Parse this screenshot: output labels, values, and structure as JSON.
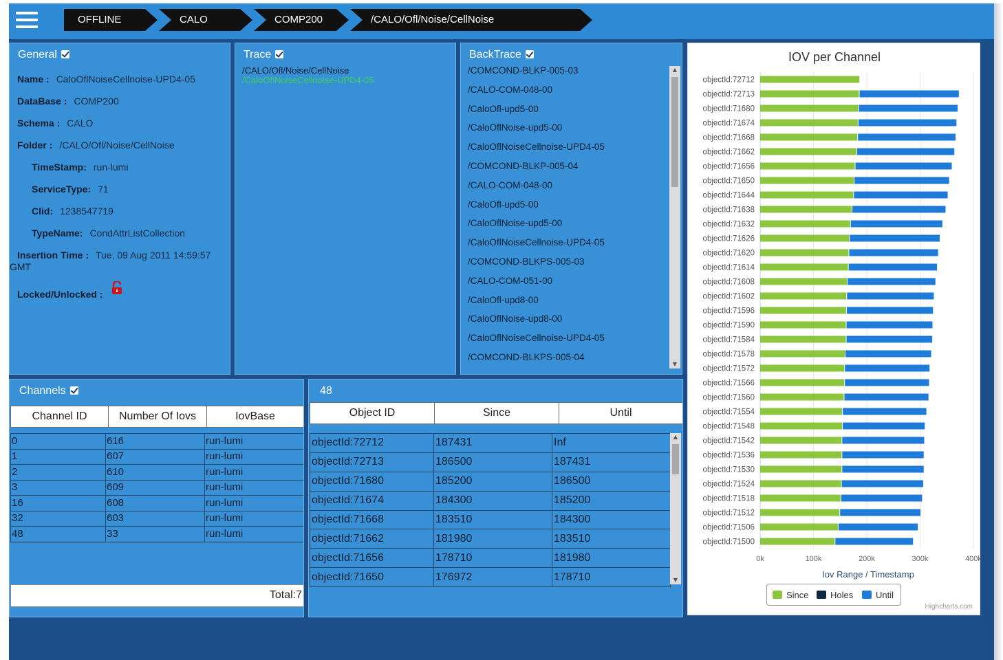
{
  "breadcrumbs": [
    "OFFLINE",
    "CALO",
    "COMP200",
    "/CALO/Ofl/Noise/CellNoise"
  ],
  "general": {
    "title": "General",
    "rows": [
      {
        "label": "Name :",
        "value": "CaloOflNoiseCellnoise-UPD4-05"
      },
      {
        "label": "DataBase :",
        "value": "COMP200"
      },
      {
        "label": "Schema :",
        "value": "CALO"
      },
      {
        "label": "Folder :",
        "value": "/CALO/Ofl/Noise/CellNoise"
      },
      {
        "label": "TimeStamp:",
        "value": "run-lumi"
      },
      {
        "label": "ServiceType:",
        "value": "71"
      },
      {
        "label": "Clid:",
        "value": "1238547719"
      },
      {
        "label": "TypeName:",
        "value": "CondAttrListCollection"
      },
      {
        "label": "Insertion Time :",
        "value": "Tue, 09 Aug 2011 14:59:57"
      }
    ],
    "insertion_tz": "GMT",
    "locked_label": "Locked/Unlocked :"
  },
  "trace": {
    "title": "Trace",
    "line1": "/CALO/Ofl/Noise/CellNoise",
    "line2": "/CaloOflNoiseCellnoise-UPD4-05"
  },
  "backtrace": {
    "title": "BackTrace",
    "items": [
      "/COMCOND-BLKP-005-03",
      "/CALO-COM-048-00",
      "/CaloOfl-upd5-00",
      "/CaloOflNoise-upd5-00",
      "/CaloOflNoiseCellnoise-UPD4-05",
      "/COMCOND-BLKP-005-04",
      "/CALO-COM-048-00",
      "/CaloOfl-upd5-00",
      "/CaloOflNoise-upd5-00",
      "/CaloOflNoiseCellnoise-UPD4-05",
      "/COMCOND-BLKPS-005-03",
      "/CALO-COM-051-00",
      "/CaloOfl-upd8-00",
      "/CaloOflNoise-upd8-00",
      "/CaloOflNoiseCellnoise-UPD4-05",
      "/COMCOND-BLKPS-005-04"
    ]
  },
  "channels": {
    "title": "Channels",
    "columns": [
      "Channel ID",
      "Number Of Iovs",
      "IovBase"
    ],
    "rows": [
      [
        "0",
        "616",
        "run-lumi"
      ],
      [
        "1",
        "607",
        "run-lumi"
      ],
      [
        "2",
        "610",
        "run-lumi"
      ],
      [
        "3",
        "609",
        "run-lumi"
      ],
      [
        "16",
        "608",
        "run-lumi"
      ],
      [
        "32",
        "603",
        "run-lumi"
      ],
      [
        "48",
        "33",
        "run-lumi"
      ]
    ],
    "total": "Total:7"
  },
  "iovs": {
    "title": "48",
    "columns": [
      "Object ID",
      "Since",
      "Until"
    ],
    "rows": [
      [
        "objectId:72712",
        "187431",
        "Inf"
      ],
      [
        "objectId:72713",
        "186500",
        "187431"
      ],
      [
        "objectId:71680",
        "185200",
        "186500"
      ],
      [
        "objectId:71674",
        "184300",
        "185200"
      ],
      [
        "objectId:71668",
        "183510",
        "184300"
      ],
      [
        "objectId:71662",
        "181980",
        "183510"
      ],
      [
        "objectId:71656",
        "178710",
        "181980"
      ],
      [
        "objectId:71650",
        "176972",
        "178710"
      ]
    ]
  },
  "colors": {
    "since": "#8cc63f",
    "holes": "#0f2740",
    "until": "#1f7bd8"
  },
  "chart_data": {
    "type": "bar",
    "orientation": "horizontal",
    "stacked": true,
    "title": "IOV per Channel",
    "xlabel": "Iov Range / Timestamp",
    "ylabel": "",
    "xlim": [
      0,
      400000
    ],
    "xticks": [
      "0k",
      "100k",
      "200k",
      "300k",
      "400k"
    ],
    "grid": true,
    "legend_position": "bottom-center",
    "credits": "Highcharts.com",
    "categories": [
      "objectId:72712",
      "objectId:72713",
      "objectId:71680",
      "objectId:71674",
      "objectId:71668",
      "objectId:71662",
      "objectId:71656",
      "objectId:71650",
      "objectId:71644",
      "objectId:71638",
      "objectId:71632",
      "objectId:71626",
      "objectId:71620",
      "objectId:71614",
      "objectId:71608",
      "objectId:71602",
      "objectId:71596",
      "objectId:71590",
      "objectId:71584",
      "objectId:71578",
      "objectId:71572",
      "objectId:71566",
      "objectId:71560",
      "objectId:71554",
      "objectId:71548",
      "objectId:71542",
      "objectId:71536",
      "objectId:71530",
      "objectId:71524",
      "objectId:71518",
      "objectId:71512",
      "objectId:71506",
      "objectId:71500"
    ],
    "series": [
      {
        "name": "Since",
        "values": [
          187431,
          186500,
          185200,
          184300,
          183510,
          181980,
          178710,
          176972,
          176000,
          173000,
          170000,
          168000,
          167000,
          166000,
          164000,
          163000,
          162500,
          162000,
          162000,
          160000,
          159000,
          159000,
          158000,
          155000,
          155000,
          154000,
          154000,
          154000,
          153000,
          152000,
          150000,
          147000,
          141000
        ]
      },
      {
        "name": "Holes",
        "values": [
          0,
          0,
          0,
          0,
          0,
          0,
          0,
          0,
          0,
          0,
          0,
          0,
          0,
          0,
          0,
          0,
          0,
          0,
          0,
          0,
          0,
          0,
          0,
          0,
          0,
          0,
          0,
          0,
          0,
          0,
          0,
          0,
          0
        ]
      },
      {
        "name": "Until",
        "values": [
          0,
          187431,
          186500,
          185200,
          184300,
          183510,
          181980,
          178710,
          176972,
          176000,
          173000,
          170000,
          168000,
          167000,
          166000,
          164000,
          163000,
          162500,
          162000,
          162000,
          160000,
          159000,
          159000,
          158000,
          155000,
          155000,
          154000,
          154000,
          154000,
          153000,
          152000,
          150000,
          147000
        ]
      }
    ]
  }
}
